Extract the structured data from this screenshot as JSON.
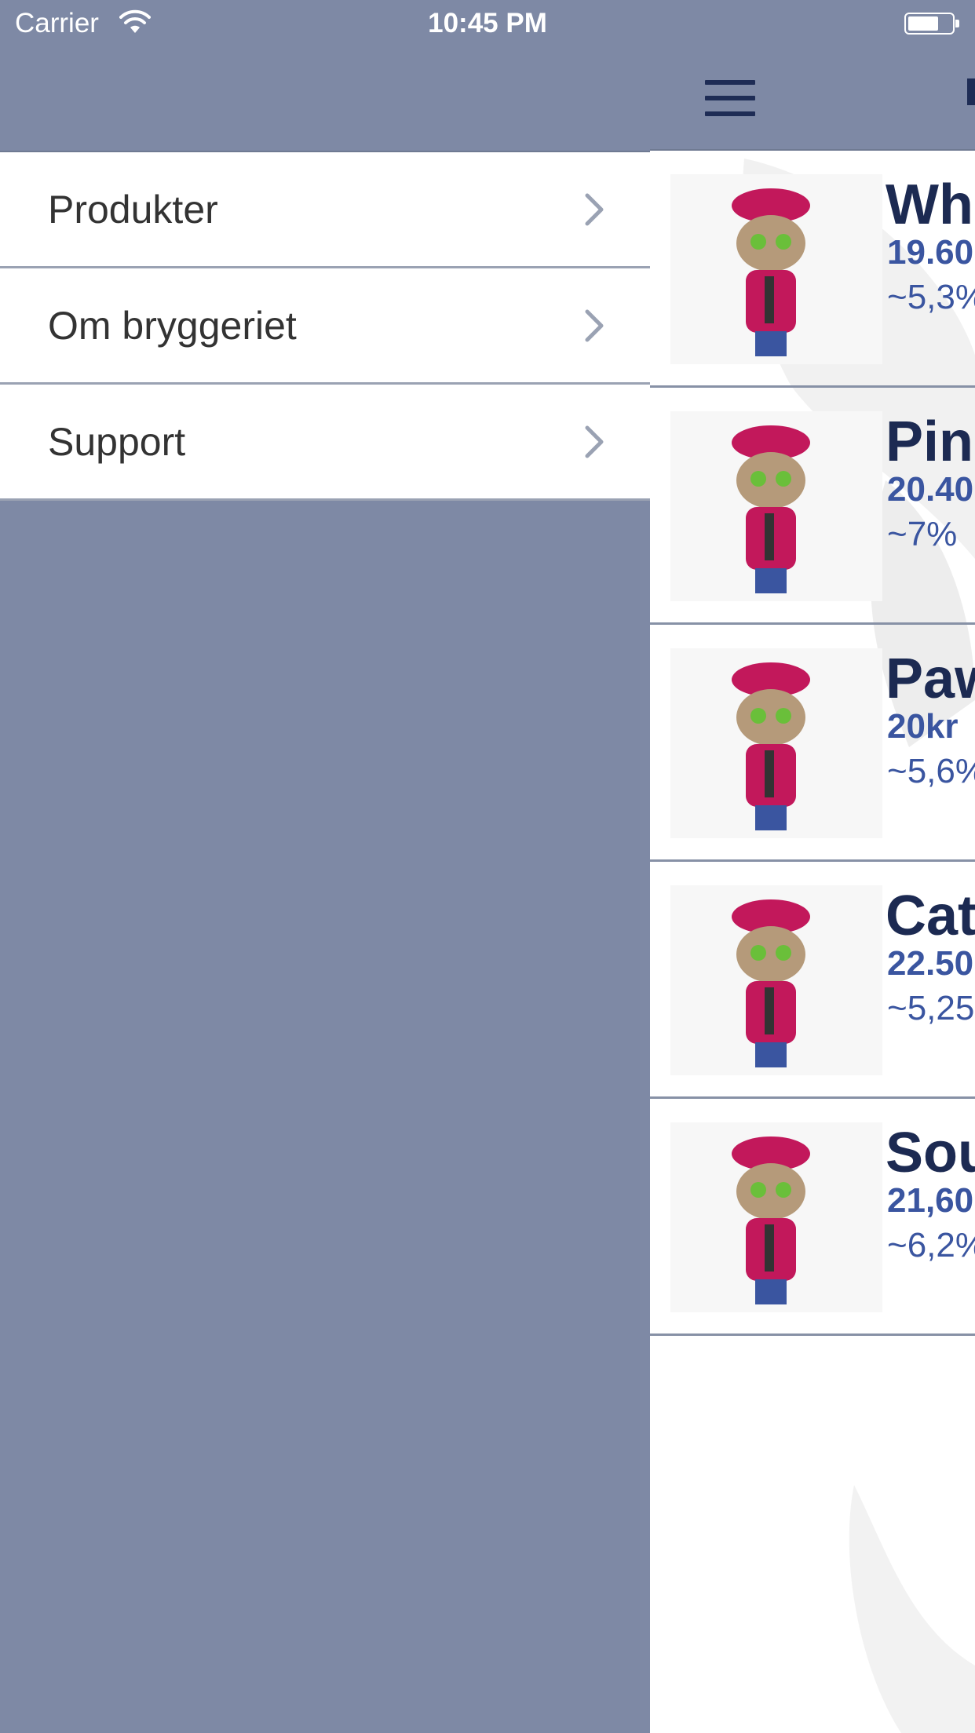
{
  "status_bar": {
    "carrier": "Carrier",
    "time": "10:45 PM"
  },
  "menu": {
    "items": [
      {
        "label": "Produkter"
      },
      {
        "label": "Om bryggeriet"
      },
      {
        "label": "Support"
      }
    ]
  },
  "products": [
    {
      "name": "Wh",
      "price": "19.60",
      "abv": "~5,3%"
    },
    {
      "name": "Pin",
      "price": "20.40",
      "abv": "~7%"
    },
    {
      "name": "Paw",
      "price": "20kr",
      "abv": "~5,6%"
    },
    {
      "name": "Cat",
      "price": "22.50",
      "abv": "~5,25"
    },
    {
      "name": "Sou",
      "price": "21,60",
      "abv": "~6,2%"
    }
  ],
  "colors": {
    "background": "#7e89a5",
    "nav_icon": "#1e2c55",
    "product_name": "#1c2a52",
    "product_price": "#3a55a0"
  }
}
